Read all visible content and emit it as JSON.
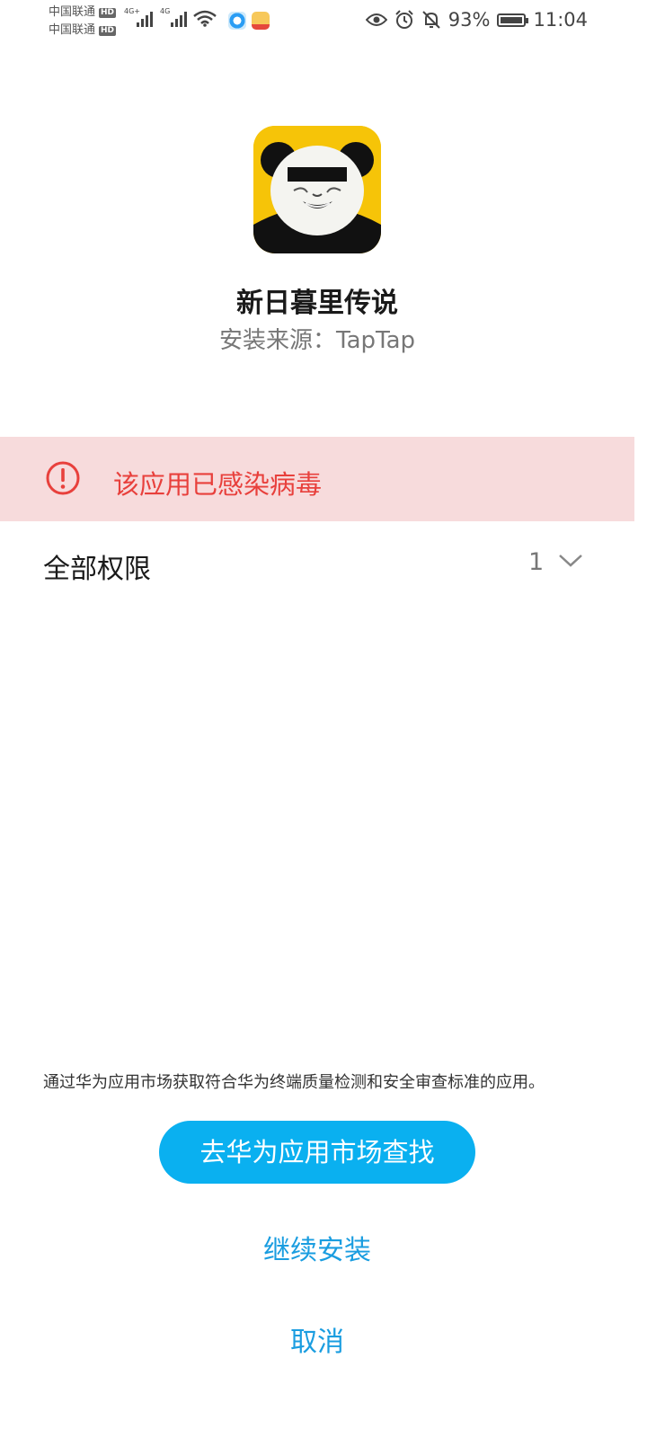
{
  "status_bar": {
    "carrier1": "中国联通",
    "carrier2": "中国联通",
    "hd_badge": "HD",
    "network1": "4G+",
    "network2": "4G",
    "battery": "93%",
    "time": "11:04"
  },
  "app": {
    "name": "新日暮里传说",
    "source": "安装来源：TapTap",
    "icon": "panda-meme-icon"
  },
  "warning": {
    "text": "该应用已感染病毒",
    "icon": "exclamation-circle-icon",
    "color": "#e8403c",
    "background": "#f7dbdc"
  },
  "permissions": {
    "label": "全部权限",
    "count": "1"
  },
  "footer": {
    "notice": "通过华为应用市场获取符合华为终端质量检测和安全审查标准的应用。",
    "market_button": "去华为应用市场查找",
    "continue_button": "继续安装",
    "cancel_button": "取消"
  },
  "colors": {
    "accent": "#0ab0f0",
    "link": "#1a9de0"
  }
}
